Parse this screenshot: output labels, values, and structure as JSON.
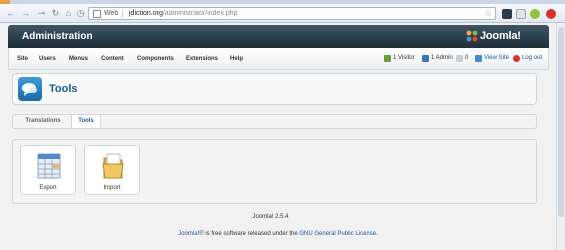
{
  "browser": {
    "web_label": "Web",
    "url_domain": "jdiction.org",
    "url_path": "/administrator/index.php"
  },
  "header": {
    "title": "Administration",
    "logo_text": "Joomla!"
  },
  "menu": {
    "items": [
      "Site",
      "Users",
      "Menus",
      "Content",
      "Components",
      "Extensions",
      "Help"
    ]
  },
  "status": {
    "visitors": "1 Visitor",
    "admins": "1 Admin",
    "messages": "0",
    "view_site": "View Site",
    "logout": "Log out"
  },
  "toolbar": {
    "title": "Tools"
  },
  "subnav": {
    "tabs": [
      "Translations",
      "Tools"
    ],
    "active": "Tools"
  },
  "quickicons": [
    {
      "label": "Export"
    },
    {
      "label": "Import"
    }
  ],
  "footer": {
    "version": "Joomla! 2.5.4",
    "license_link": "Joomla!®",
    "license_text": " is free software released under the ",
    "license_name": "GNU General Public License",
    "license_end": "."
  }
}
